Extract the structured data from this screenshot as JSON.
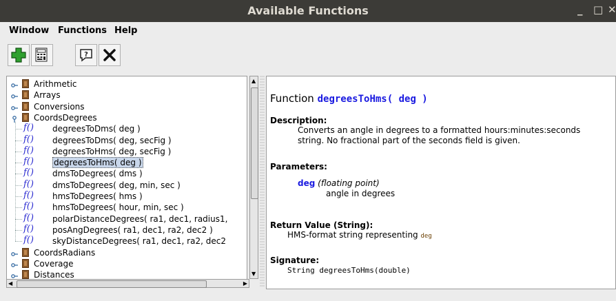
{
  "window": {
    "title": "Available Functions",
    "minimize": "_",
    "maximize": "□",
    "close": "✕"
  },
  "menu": [
    {
      "label": "Window"
    },
    {
      "label": "Functions"
    },
    {
      "label": "Help"
    }
  ],
  "toolbar": [
    {
      "icon": "add-icon"
    },
    {
      "icon": "calculator-icon"
    },
    {
      "icon": "help-icon"
    },
    {
      "icon": "close-icon"
    }
  ],
  "tree": {
    "categories_top": [
      "Arithmetic",
      "Arrays",
      "Conversions"
    ],
    "expanded": "CoordsDegrees",
    "function_glyph": "f()",
    "functions": [
      "degreesToDms( deg )",
      "degreesToDms( deg, secFig )",
      "degreesToHms( deg, secFig )",
      "degreesToHms( deg )",
      "dmsToDegrees( dms )",
      "dmsToDegrees( deg, min, sec )",
      "hmsToDegrees( hms )",
      "hmsToDegrees( hour, min, sec )",
      "polarDistanceDegrees( ra1, dec1, radius1,",
      "posAngDegrees( ra1, dec1, ra2, dec2 )",
      "skyDistanceDegrees( ra1, dec1, ra2, dec2"
    ],
    "selected_index": 3,
    "categories_bottom": [
      "CoordsRadians",
      "Coverage",
      "Distances"
    ]
  },
  "doc": {
    "heading_prefix": "Function",
    "heading_name": "degreesToHms( deg )",
    "description_label": "Description:",
    "description_line1": "Converts an angle in degrees to a formatted hours:minutes:seconds",
    "description_line2": "string. No fractional part of the seconds field is given.",
    "parameters_label": "Parameters:",
    "param_name": "deg",
    "param_type": "(floating point)",
    "param_desc": "angle in degrees",
    "return_label": "Return Value (String):",
    "return_desc": "HMS-format string representing",
    "return_ref": "deg",
    "signature_label": "Signature:",
    "signature": "String degreesToHms(double)"
  },
  "colors": {
    "title_bg": "#3c3b37",
    "link_blue": "#1a1ae0",
    "selection": "#c8d6ea"
  }
}
